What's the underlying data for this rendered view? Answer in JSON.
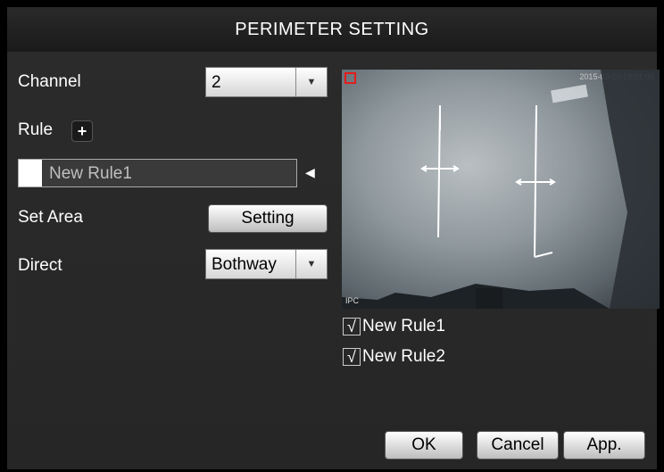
{
  "title": "PERIMETER SETTING",
  "channel": {
    "label": "Channel",
    "value": "2"
  },
  "rule": {
    "label": "Rule",
    "add_icon": "plus-icon",
    "selected": "New Rule1"
  },
  "set_area": {
    "label": "Set Area",
    "button": "Setting"
  },
  "direct": {
    "label": "Direct",
    "value": "Bothway"
  },
  "preview": {
    "timestamp": "2015-03-10 18:01:00",
    "camera_label": "IPC"
  },
  "rules_list": [
    {
      "label": "New Rule1",
      "checked": true
    },
    {
      "label": "New Rule2",
      "checked": true
    }
  ],
  "buttons": {
    "ok": "OK",
    "cancel": "Cancel",
    "apply": "App."
  },
  "colors": {
    "accent_red": "#e31c1c",
    "line": "#ffffff"
  }
}
